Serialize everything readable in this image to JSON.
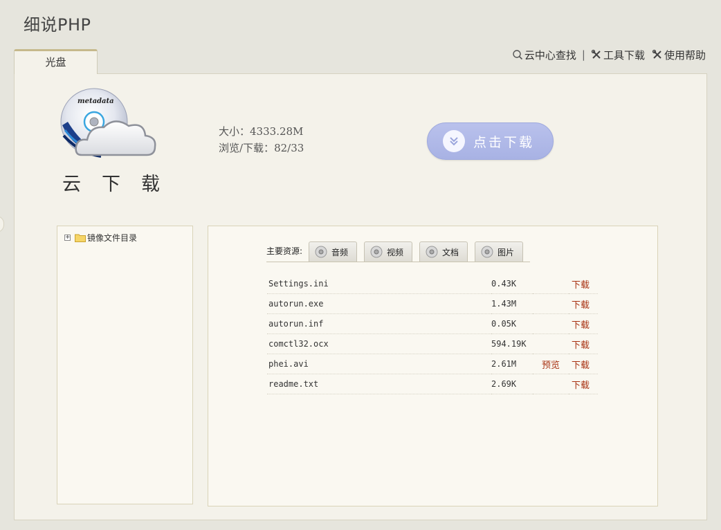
{
  "header": {
    "title": "细说PHP"
  },
  "tabs": [
    {
      "label": "光盘"
    }
  ],
  "top_links": [
    {
      "label": "云中心查找",
      "icon": "search-icon"
    },
    {
      "label": "|"
    },
    {
      "label": "工具下载",
      "icon": "tools-icon"
    },
    {
      "label": "使用帮助",
      "icon": "tools-icon"
    }
  ],
  "disc": {
    "logo_text": "metadata",
    "caption": "云下载",
    "size_label": "大小：",
    "size_value": "4333.28M",
    "stats_label": "浏览/下载：",
    "stats_value": "82/33",
    "download_button": "点击下载"
  },
  "tree": {
    "root_label": "镜像文件目录"
  },
  "resources": {
    "label": "主要资源:",
    "tabs": [
      {
        "label": "音频",
        "icon": "cd-icon"
      },
      {
        "label": "视频",
        "icon": "cd-icon"
      },
      {
        "label": "文档",
        "icon": "cd-icon"
      },
      {
        "label": "图片",
        "icon": "cd-icon"
      }
    ]
  },
  "files": [
    {
      "name": "Settings.ini",
      "size": "0.43K",
      "preview": "",
      "download": "下载"
    },
    {
      "name": "autorun.exe",
      "size": "1.43M",
      "preview": "",
      "download": "下载"
    },
    {
      "name": "autorun.inf",
      "size": "0.05K",
      "preview": "",
      "download": "下载"
    },
    {
      "name": "comctl32.ocx",
      "size": "594.19K",
      "preview": "",
      "download": "下载"
    },
    {
      "name": "phei.avi",
      "size": "2.61M",
      "preview": "预览",
      "download": "下载"
    },
    {
      "name": "readme.txt",
      "size": "2.69K",
      "preview": "",
      "download": "下载"
    }
  ],
  "colors": {
    "background": "#e6e5dd",
    "panel": "#f4f2ea",
    "download_button": "#b1baea",
    "link_red": "#a83212"
  }
}
